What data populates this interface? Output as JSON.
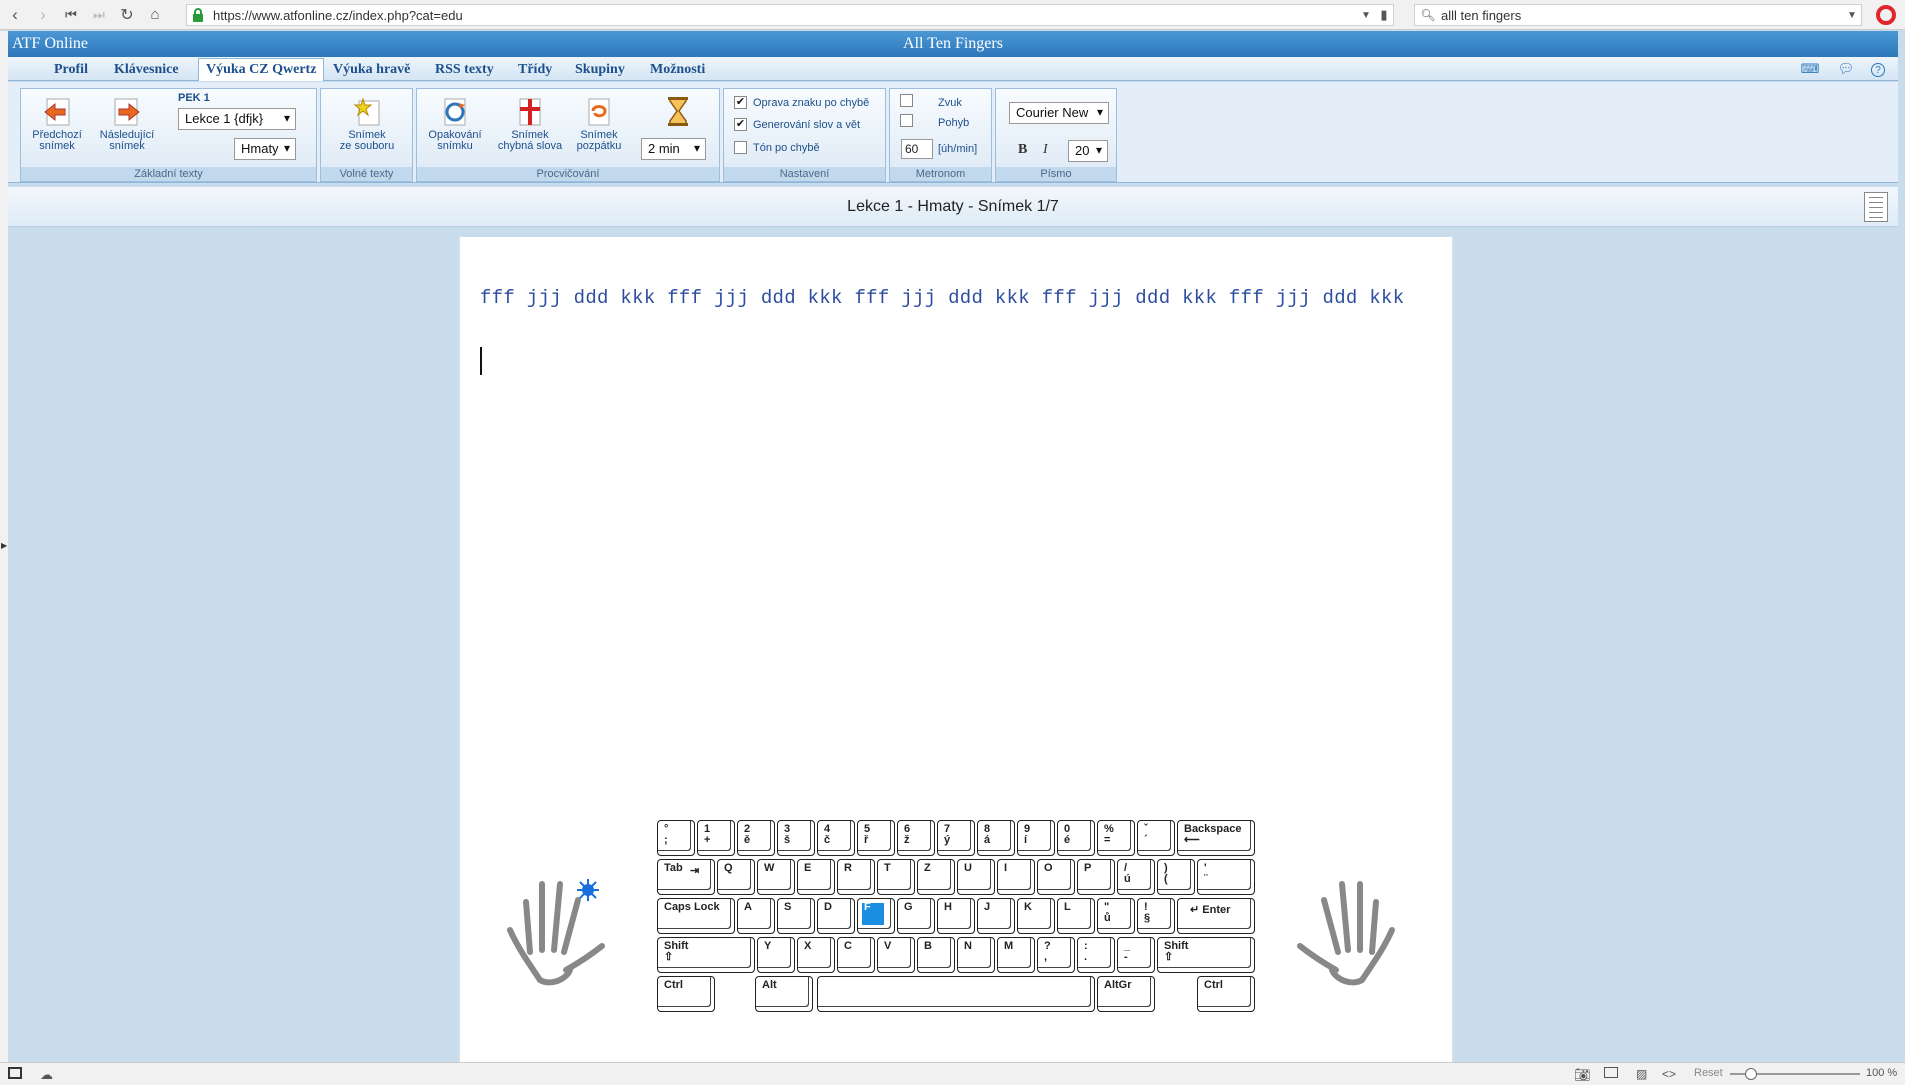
{
  "browser": {
    "url": "https://www.atfonline.cz/index.php?cat=edu",
    "search": "alll ten fingers"
  },
  "app": {
    "brand": "ATF Online",
    "title": "All Ten Fingers"
  },
  "menu": [
    "Profil",
    "Klávesnice",
    "Výuka CZ Qwertz",
    "Výuka hravě",
    "RSS texty",
    "Třídy",
    "Skupiny",
    "Možnosti"
  ],
  "ribbon": {
    "zakladni": {
      "label": "Základní texty",
      "prev": [
        "Předchozí",
        "snímek"
      ],
      "next": [
        "Následující",
        "snímek"
      ],
      "pek": "PEK 1",
      "lesson_select": "Lekce 1 {dfjk}",
      "mode_select": "Hmaty"
    },
    "volne": {
      "label": "Volné texty",
      "from_file": [
        "Snímek",
        "ze souboru"
      ]
    },
    "procvicovani": {
      "label": "Procvičování",
      "repeat": [
        "Opakování",
        "snímku"
      ],
      "wrong": [
        "Snímek",
        "chybná slova"
      ],
      "backwards": [
        "Snímek",
        "pozpátku"
      ],
      "time_select": "2 min"
    },
    "nastaveni": {
      "label": "Nastavení",
      "opt1": "Oprava znaku po chybě",
      "opt1_checked": "✔",
      "opt2": "Generování slov a vět",
      "opt2_checked": "✔",
      "opt3": "Tón po chybě"
    },
    "metronom": {
      "label": "Metronom",
      "sound": "Zvuk",
      "motion": "Pohyb",
      "tempo": "60",
      "unit": "[úh/min]"
    },
    "pismo": {
      "label": "Písmo",
      "font_select": "Courier New",
      "bold": "B",
      "italic": "I",
      "size_select": "20"
    }
  },
  "lesson": {
    "title": "Lekce 1 - Hmaty - Snímek 1/7",
    "drill": "fff jjj ddd kkk fff jjj ddd kkk fff jjj ddd kkk fff jjj ddd kkk fff jjj ddd kkk"
  },
  "keyboard": {
    "highlight_key": "F",
    "row1": [
      [
        "°",
        ";"
      ],
      [
        "1",
        "+"
      ],
      [
        "2",
        "ě"
      ],
      [
        "3",
        "š"
      ],
      [
        "4",
        "č"
      ],
      [
        "5",
        "ř"
      ],
      [
        "6",
        "ž"
      ],
      [
        "7",
        "ý"
      ],
      [
        "8",
        "á"
      ],
      [
        "9",
        "í"
      ],
      [
        "0",
        "é"
      ],
      [
        "%",
        "="
      ],
      [
        "ˇ",
        "´"
      ]
    ],
    "row1_end": "Backspace",
    "row2_start": "Tab",
    "row2": [
      [
        "Q",
        ""
      ],
      [
        "W",
        ""
      ],
      [
        "E",
        ""
      ],
      [
        "R",
        ""
      ],
      [
        "T",
        ""
      ],
      [
        "Z",
        ""
      ],
      [
        "U",
        ""
      ],
      [
        "I",
        ""
      ],
      [
        "O",
        ""
      ],
      [
        "P",
        ""
      ],
      [
        "/",
        "ú"
      ],
      [
        ")",
        "("
      ],
      [
        "'",
        "¨"
      ]
    ],
    "row3_start": "Caps Lock",
    "row3": [
      [
        "A",
        ""
      ],
      [
        "S",
        ""
      ],
      [
        "D",
        ""
      ],
      [
        "F",
        ""
      ],
      [
        "G",
        ""
      ],
      [
        "H",
        ""
      ],
      [
        "J",
        ""
      ],
      [
        "K",
        ""
      ],
      [
        "L",
        ""
      ],
      [
        "\"",
        "ů"
      ],
      [
        "!",
        "§"
      ]
    ],
    "row3_end": "Enter",
    "row4_start": "Shift",
    "row4": [
      [
        "Y",
        ""
      ],
      [
        "X",
        ""
      ],
      [
        "C",
        ""
      ],
      [
        "V",
        ""
      ],
      [
        "B",
        ""
      ],
      [
        "N",
        ""
      ],
      [
        "M",
        ""
      ],
      [
        "?",
        ","
      ],
      [
        ":",
        "."
      ],
      [
        "_",
        "-"
      ]
    ],
    "row4_end": "Shift",
    "row5": [
      "Ctrl",
      "Alt",
      "AltGr",
      "Ctrl"
    ]
  },
  "status": {
    "reset": "Reset",
    "zoom": "100 %"
  }
}
